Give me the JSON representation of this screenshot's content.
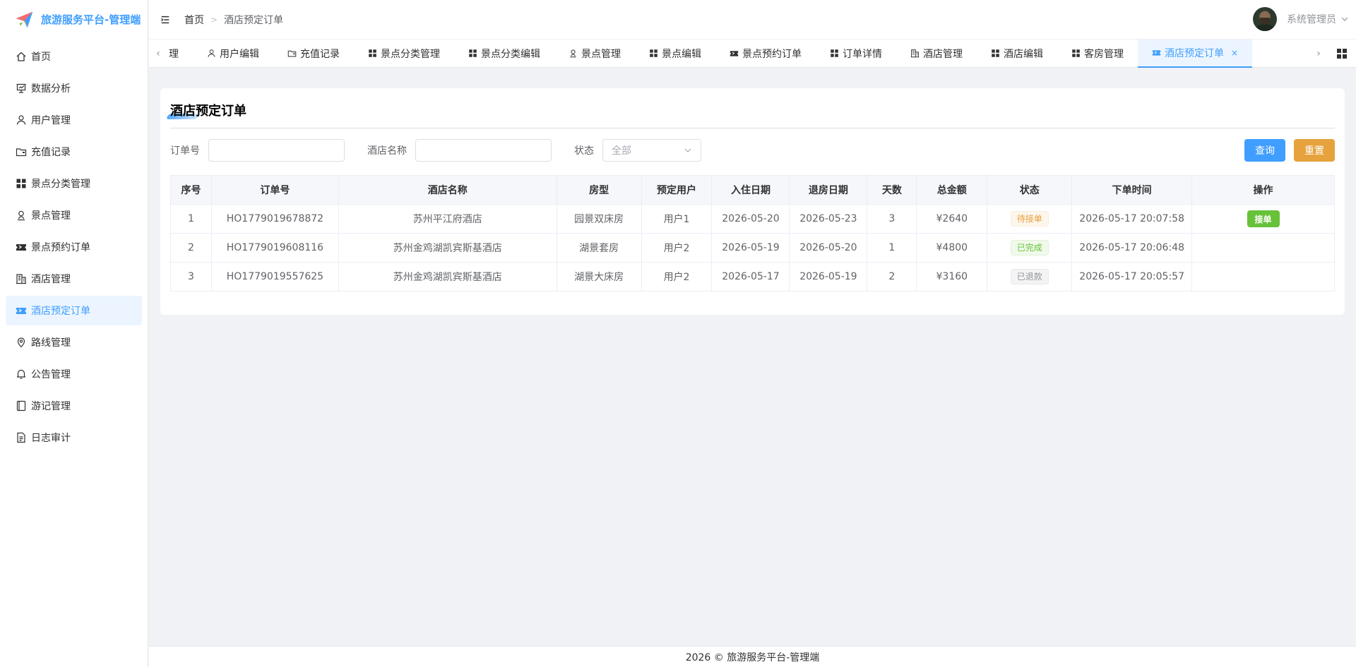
{
  "app": {
    "title": "旅游服务平台-管理端"
  },
  "sidebar": {
    "items": [
      {
        "label": "首页",
        "icon": "home-icon"
      },
      {
        "label": "数据分析",
        "icon": "presentation-chart-icon"
      },
      {
        "label": "用户管理",
        "icon": "user-icon"
      },
      {
        "label": "充值记录",
        "icon": "wallet-icon"
      },
      {
        "label": "景点分类管理",
        "icon": "grid-icon"
      },
      {
        "label": "景点管理",
        "icon": "location-user-icon"
      },
      {
        "label": "景点预约订单",
        "icon": "ticket-icon"
      },
      {
        "label": "酒店管理",
        "icon": "building-icon"
      },
      {
        "label": "酒店预定订单",
        "icon": "ticket-icon",
        "active": true
      },
      {
        "label": "路线管理",
        "icon": "map-pin-icon"
      },
      {
        "label": "公告管理",
        "icon": "bell-icon"
      },
      {
        "label": "游记管理",
        "icon": "notebook-icon"
      },
      {
        "label": "日志审计",
        "icon": "document-icon"
      }
    ]
  },
  "header": {
    "breadcrumb_home": "首页",
    "breadcrumb_current": "酒店预定订单",
    "user_name": "系统管理员"
  },
  "tabs": [
    {
      "label": "理",
      "icon": ""
    },
    {
      "label": "用户编辑",
      "icon": "user-icon"
    },
    {
      "label": "充值记录",
      "icon": "wallet-icon"
    },
    {
      "label": "景点分类管理",
      "icon": "grid-icon"
    },
    {
      "label": "景点分类编辑",
      "icon": "grid-icon"
    },
    {
      "label": "景点管理",
      "icon": "location-user-icon"
    },
    {
      "label": "景点编辑",
      "icon": "grid-icon"
    },
    {
      "label": "景点预约订单",
      "icon": "ticket-icon"
    },
    {
      "label": "订单详情",
      "icon": "grid-icon"
    },
    {
      "label": "酒店管理",
      "icon": "building-icon"
    },
    {
      "label": "酒店编辑",
      "icon": "grid-icon"
    },
    {
      "label": "客房管理",
      "icon": "grid-icon"
    },
    {
      "label": "酒店预定订单",
      "icon": "ticket-icon",
      "active": true,
      "close": "×"
    }
  ],
  "page": {
    "title": "酒店预定订单"
  },
  "search": {
    "order_no_label": "订单号",
    "order_no_value": "",
    "hotel_name_label": "酒店名称",
    "hotel_name_value": "",
    "status_label": "状态",
    "status_value": "全部",
    "query_button": "查询",
    "reset_button": "重置"
  },
  "table": {
    "columns": [
      "序号",
      "订单号",
      "酒店名称",
      "房型",
      "预定用户",
      "入住日期",
      "退房日期",
      "天数",
      "总金额",
      "状态",
      "下单时间",
      "操作"
    ],
    "rows": [
      {
        "index": "1",
        "order_no": "HO1779019678872",
        "hotel": "苏州平江府酒店",
        "room": "园景双床房",
        "user": "用户1",
        "checkin": "2026-05-20",
        "checkout": "2026-05-23",
        "days": "3",
        "amount": "¥2640",
        "status": "待接单",
        "status_type": "pending",
        "created": "2026-05-17 20:07:58",
        "action": "接单"
      },
      {
        "index": "2",
        "order_no": "HO1779019608116",
        "hotel": "苏州金鸡湖凯宾斯基酒店",
        "room": "湖景套房",
        "user": "用户2",
        "checkin": "2026-05-19",
        "checkout": "2026-05-20",
        "days": "1",
        "amount": "¥4800",
        "status": "已完成",
        "status_type": "done",
        "created": "2026-05-17 20:06:48",
        "action": ""
      },
      {
        "index": "3",
        "order_no": "HO1779019557625",
        "hotel": "苏州金鸡湖凯宾斯基酒店",
        "room": "湖景大床房",
        "user": "用户2",
        "checkin": "2026-05-17",
        "checkout": "2026-05-19",
        "days": "2",
        "amount": "¥3160",
        "status": "已退款",
        "status_type": "refund",
        "created": "2026-05-17 20:05:57",
        "action": ""
      }
    ]
  },
  "footer": {
    "text": "2026 © 旅游服务平台-管理端"
  },
  "colors": {
    "primary": "#409eff",
    "warning": "#e6a23c",
    "success": "#67c23a",
    "info": "#909399"
  }
}
